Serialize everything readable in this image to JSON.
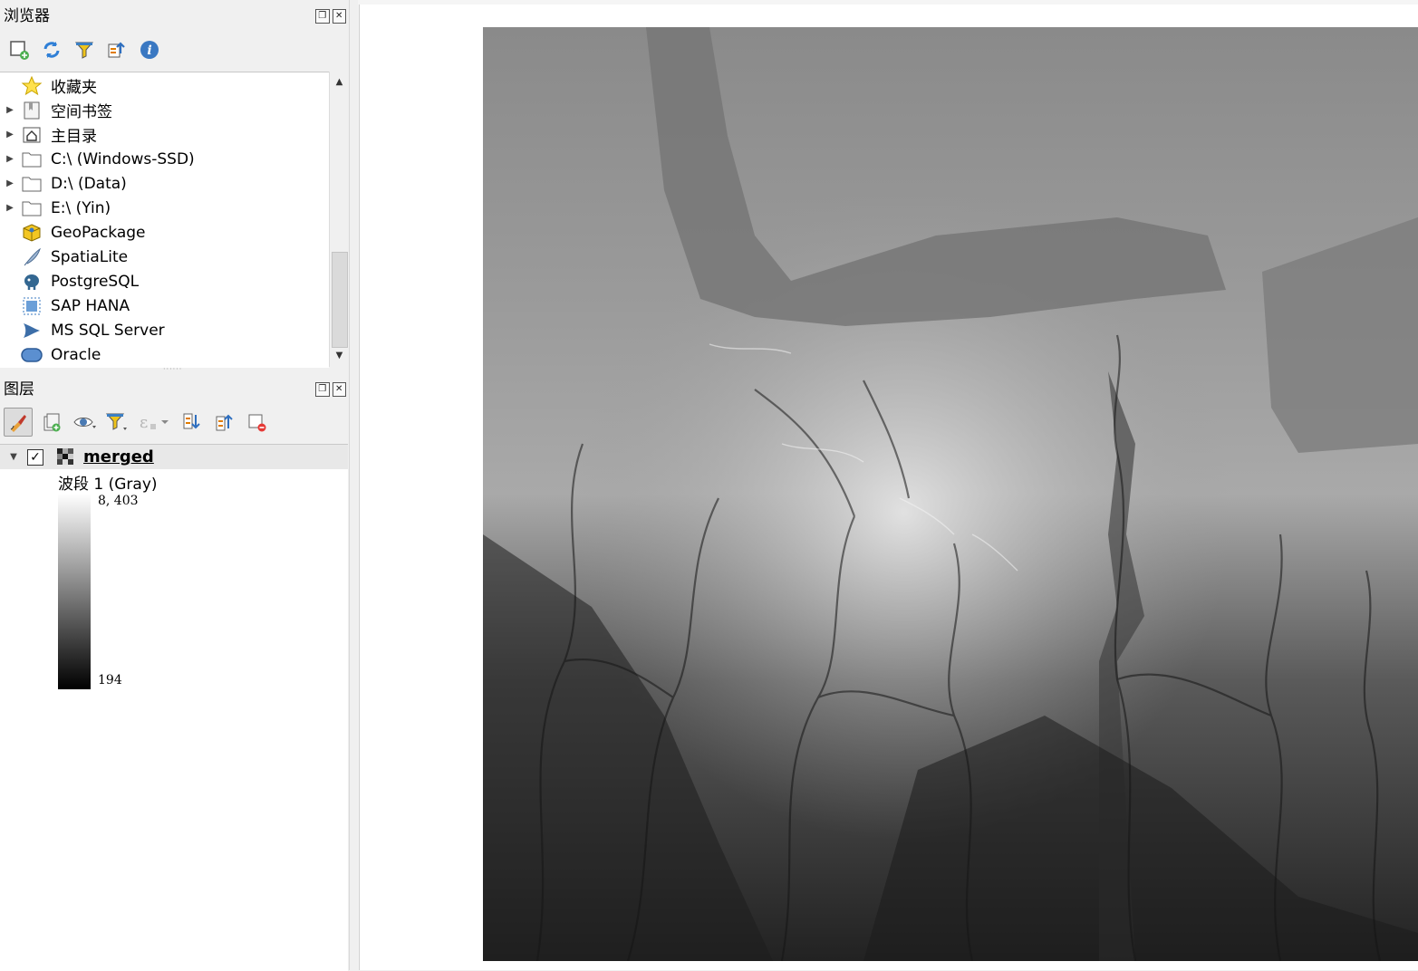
{
  "browser_panel": {
    "title": "浏览器",
    "toolbar": [
      "add-layer-icon",
      "refresh-icon",
      "filter-icon",
      "collapse-all-icon",
      "info-icon"
    ],
    "items": [
      {
        "label": "收藏夹",
        "icon": "star-icon",
        "expandable": false
      },
      {
        "label": "空间书签",
        "icon": "bookmark-icon",
        "expandable": true
      },
      {
        "label": "主目录",
        "icon": "home-icon",
        "expandable": true
      },
      {
        "label": "C:\\ (Windows-SSD)",
        "icon": "folder-icon",
        "expandable": true
      },
      {
        "label": "D:\\ (Data)",
        "icon": "folder-icon",
        "expandable": true
      },
      {
        "label": "E:\\ (Yin)",
        "icon": "folder-icon",
        "expandable": true
      },
      {
        "label": "GeoPackage",
        "icon": "geopackage-icon",
        "expandable": false
      },
      {
        "label": "SpatiaLite",
        "icon": "spatialite-icon",
        "expandable": false
      },
      {
        "label": "PostgreSQL",
        "icon": "postgresql-icon",
        "expandable": false
      },
      {
        "label": "SAP HANA",
        "icon": "sap-hana-icon",
        "expandable": false
      },
      {
        "label": "MS SQL Server",
        "icon": "mssql-icon",
        "expandable": false
      },
      {
        "label": "Oracle",
        "icon": "oracle-icon",
        "expandable": false
      }
    ]
  },
  "layers_panel": {
    "title": "图层",
    "toolbar": [
      "style-icon",
      "add-group-icon",
      "visibility-icon",
      "filter-legend-icon",
      "expression-filter-icon",
      "expand-all-icon",
      "collapse-all-icon",
      "remove-layer-icon"
    ],
    "layers": [
      {
        "name": "merged",
        "checked": true,
        "band": "波段 1 (Gray)",
        "max": "8, 403",
        "min": "194"
      }
    ]
  },
  "colors": {
    "panel_bg": "#f0f0f0",
    "tree_bg": "#ffffff",
    "accent_blue": "#2f6fbf"
  }
}
